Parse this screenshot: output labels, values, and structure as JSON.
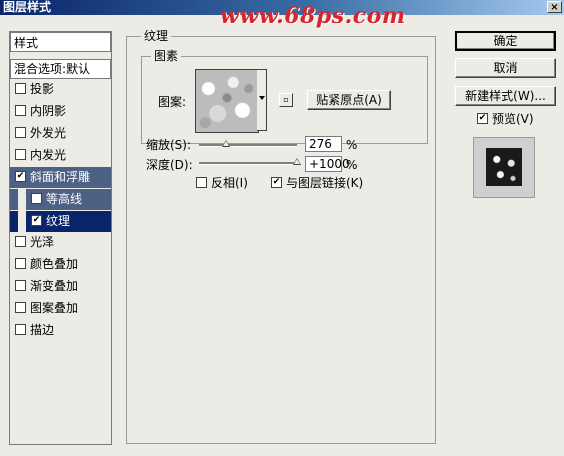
{
  "window": {
    "title": "图层样式",
    "close_glyph": "×"
  },
  "watermark": "www.68ps.com",
  "sidebar": {
    "header": "样式",
    "blend_options": "混合选项:默认",
    "items": [
      {
        "label": "投影",
        "checked": false
      },
      {
        "label": "内阴影",
        "checked": false
      },
      {
        "label": "外发光",
        "checked": false
      },
      {
        "label": "内发光",
        "checked": false
      },
      {
        "label": "斜面和浮雕",
        "checked": true
      },
      {
        "label": "等高线",
        "checked": false
      },
      {
        "label": "纹理",
        "checked": true
      },
      {
        "label": "光泽",
        "checked": false
      },
      {
        "label": "颜色叠加",
        "checked": false
      },
      {
        "label": "渐变叠加",
        "checked": false
      },
      {
        "label": "图案叠加",
        "checked": false
      },
      {
        "label": "描边",
        "checked": false
      }
    ]
  },
  "texture": {
    "group_title": "纹理",
    "pattern_group_title": "图素",
    "pattern_label": "图案:",
    "snap_button": "贴紧原点(A)",
    "scale_label": "缩放(S):",
    "scale_value": "276",
    "scale_unit": "%",
    "scale_level": 276,
    "depth_label": "深度(D):",
    "depth_value": "+1000",
    "depth_unit": "%",
    "depth_level": 1000,
    "invert_label": "反相(I)",
    "invert_checked": false,
    "link_label": "与图层链接(K)",
    "link_checked": true
  },
  "buttons": {
    "ok": "确定",
    "cancel": "取消",
    "new_style": "新建样式(W)...",
    "preview_label": "预览(V)",
    "preview_checked": true
  },
  "check_glyph": "✔",
  "colors": {
    "title_gradient_start": "#0a246a",
    "selected_item": "#4d6185",
    "selected_sub_item": "#0a246a",
    "watermark": "#d6262a"
  }
}
